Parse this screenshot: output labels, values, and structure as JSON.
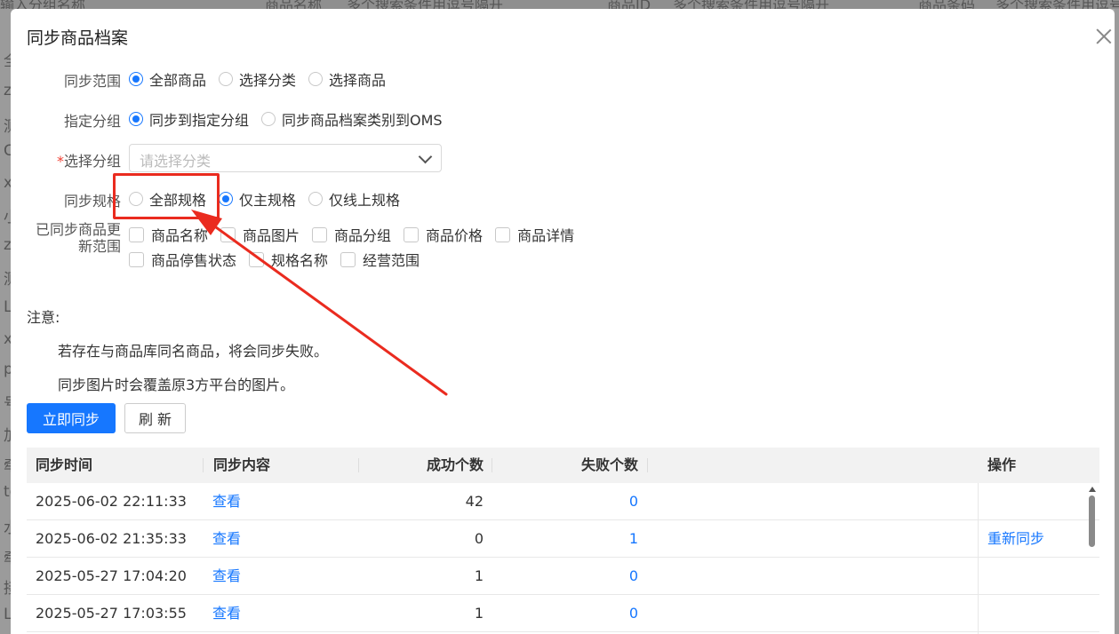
{
  "background": {
    "top_snippets": [
      "输入分组名称",
      "商品名称",
      "多个搜索条件用逗号隔开",
      "商品ID",
      "多个搜索条件用逗号隔开",
      "商品条码",
      "多个搜索条件用逗号"
    ],
    "left_snippets": [
      "全",
      "zj",
      "测",
      "C",
      "xi",
      "小",
      "zl",
      "测",
      "L",
      "xt",
      "p",
      "号",
      "加",
      "牵",
      "te",
      "水",
      "牵",
      "接",
      "L"
    ]
  },
  "modal": {
    "title": "同步商品档案",
    "sync_range": {
      "label": "同步范围",
      "options": [
        "全部商品",
        "选择分类",
        "选择商品"
      ],
      "selected": "全部商品"
    },
    "target_group": {
      "label": "指定分组",
      "options": [
        "同步到指定分组",
        "同步商品档案类别到OMS"
      ],
      "selected": "同步到指定分组"
    },
    "choose_group": {
      "required_mark": "*",
      "label": "选择分组",
      "placeholder": "请选择分类"
    },
    "sync_spec": {
      "label": "同步规格",
      "options": [
        "全部规格",
        "仅主规格",
        "仅线上规格"
      ],
      "selected": "仅主规格"
    },
    "update_scope": {
      "label_line1": "已同步商品更",
      "label_line2": "新范围",
      "row1": [
        "商品名称",
        "商品图片",
        "商品分组",
        "商品价格",
        "商品详情"
      ],
      "row2": [
        "商品停售状态",
        "规格名称",
        "经营范围"
      ]
    },
    "notes": {
      "heading": "注意:",
      "items": [
        "若存在与商品库同名商品，将会同步失败。",
        "同步图片时会覆盖原3方平台的图片。"
      ]
    },
    "buttons": {
      "sync_now": "立即同步",
      "refresh": "刷 新"
    },
    "table": {
      "headers": [
        "同步时间",
        "同步内容",
        "成功个数",
        "失败个数",
        "操作"
      ],
      "rows": [
        {
          "time": "2025-06-02 22:11:33",
          "content": "查看",
          "success": "42",
          "fail": "0",
          "action": ""
        },
        {
          "time": "2025-06-02 21:35:33",
          "content": "查看",
          "success": "0",
          "fail": "1",
          "action": "重新同步"
        },
        {
          "time": "2025-05-27 17:04:20",
          "content": "查看",
          "success": "1",
          "fail": "0",
          "action": ""
        },
        {
          "time": "2025-05-27 17:03:55",
          "content": "查看",
          "success": "1",
          "fail": "0",
          "action": ""
        }
      ]
    }
  },
  "colors": {
    "primary": "#1677ff",
    "annotation": "#ea2b1f",
    "required": "#f04134"
  }
}
